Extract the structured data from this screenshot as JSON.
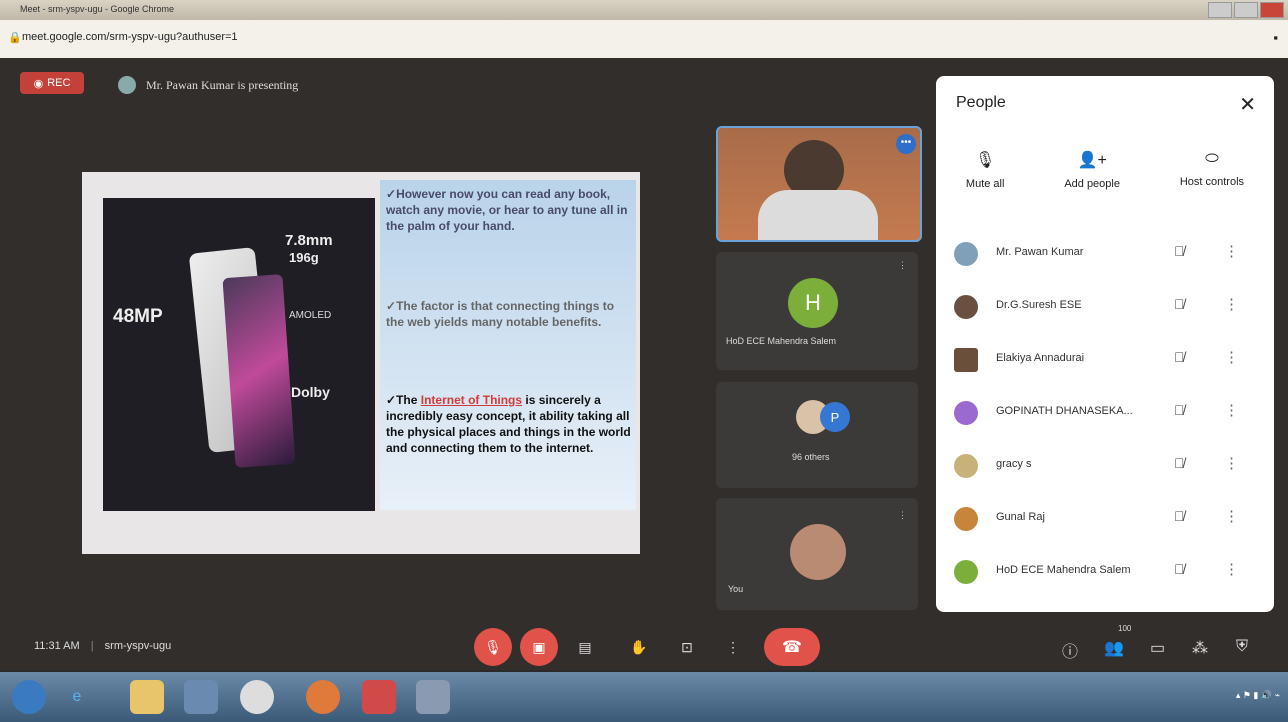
{
  "browser": {
    "title": "Meet - srm-yspv-ugu - Google Chrome",
    "url": "meet.google.com/srm-yspv-ugu?authuser=1"
  },
  "meet": {
    "rec_label": "REC",
    "presenting": "Mr. Pawan Kumar is presenting",
    "meeting_time": "11:31 AM",
    "separator": "|",
    "meeting_code": "srm-yspv-ugu",
    "participants_badge": "100"
  },
  "slide": {
    "phone": {
      "thickness": "7.8mm",
      "weight": "196g",
      "camera": "48MP",
      "display": "AMOLED",
      "audio": "Dolby"
    },
    "bullets": [
      "However now you can read any book, watch any movie, or hear to any tune all in the palm of your hand.",
      "The factor is that connecting things to the web yields many notable benefits."
    ],
    "bullet3": {
      "pre": "The ",
      "highlight": "Internet of Things",
      "post": " is sincerely a incredibly easy concept, it ability taking all the physical places and things in the world and connecting them to the internet."
    }
  },
  "tiles": {
    "h_initial": "H",
    "h_name": "HoD ECE Mahendra Salem",
    "others_initial": "P",
    "others_label": "96 others",
    "you_label": "You"
  },
  "people": {
    "title": "People",
    "close": "✕",
    "actions": [
      {
        "label": "Mute all",
        "icon": "mic-off-icon",
        "glyph": "🎙"
      },
      {
        "label": "Add people",
        "icon": "add-person-icon",
        "glyph": "👤+"
      },
      {
        "label": "Host controls",
        "icon": "host-controls-icon",
        "glyph": "⬭"
      }
    ],
    "list": [
      {
        "name": "Mr. Pawan Kumar",
        "color": "#7fa0b8"
      },
      {
        "name": "Dr.G.Suresh ESE",
        "color": "#6a5040"
      },
      {
        "name": "Elakiya Annadurai",
        "color": "#6a4f3a"
      },
      {
        "name": "GOPINATH DHANASEKA...",
        "color": "#9b6ad0"
      },
      {
        "name": "gracy s",
        "color": "#c8b27a"
      },
      {
        "name": "Gunal Raj",
        "color": "#c8843a"
      },
      {
        "name": "HoD ECE Mahendra Salem",
        "color": "#7cae3a"
      }
    ]
  },
  "colors": {
    "rec": "#c4413a",
    "end_call": "#e0524a",
    "accent": "#3478d4"
  }
}
